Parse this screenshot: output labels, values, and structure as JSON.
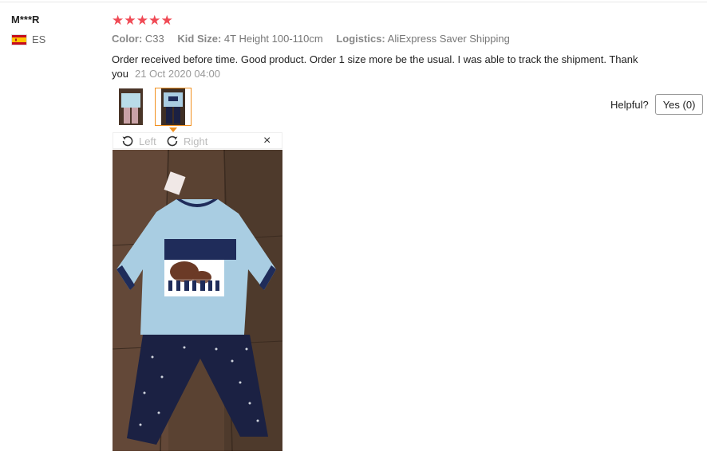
{
  "reviewer": {
    "name": "M***R",
    "country_code": "ES"
  },
  "rating": {
    "stars": 5,
    "star_color": "#f04a55"
  },
  "attributes": [
    {
      "key": "Color:",
      "value": "C33"
    },
    {
      "key": "Kid Size:",
      "value": "4T Height 100-110cm"
    },
    {
      "key": "Logistics:",
      "value": "AliExpress Saver Shipping"
    }
  ],
  "review": {
    "text": "Order received before time. Good product. Order 1 size more be the usual. I was able to track the shipment. Thank you",
    "date": "21 Oct 2020 04:00"
  },
  "helpful": {
    "label": "Helpful?",
    "yes_label": "Yes (0)"
  },
  "viewer": {
    "rotate_left": "Left",
    "rotate_right": "Right",
    "close_glyph": "×"
  },
  "icons": [
    "spain-flag-icon",
    "star-icon",
    "rotate-left-icon",
    "rotate-right-icon",
    "close-icon"
  ],
  "colors": {
    "accent_orange": "#f1901f",
    "star": "#f04a55"
  }
}
